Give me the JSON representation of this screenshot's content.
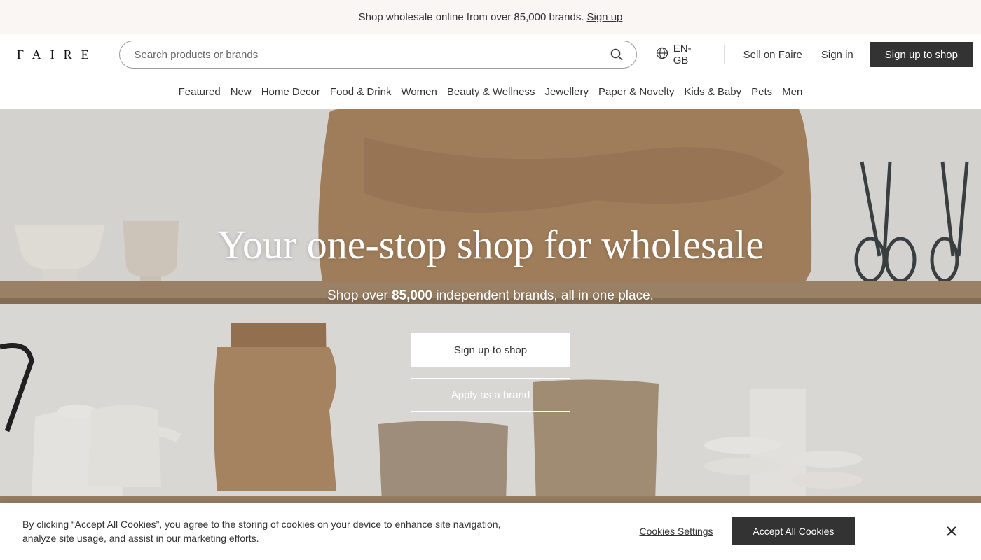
{
  "announcement": {
    "text": "Shop wholesale online from over 85,000 brands.",
    "link": "Sign up"
  },
  "header": {
    "logo": "FAIRE",
    "search_placeholder": "Search products or brands",
    "search_icon": "search-icon",
    "locale": "EN-GB",
    "locale_icon": "globe-icon",
    "sell_link": "Sell on Faire",
    "signin_link": "Sign in",
    "signup_button": "Sign up to shop"
  },
  "categories": [
    "Featured",
    "New",
    "Home Decor",
    "Food & Drink",
    "Women",
    "Beauty & Wellness",
    "Jewellery",
    "Paper & Novelty",
    "Kids & Baby",
    "Pets",
    "Men"
  ],
  "hero": {
    "title": "Your one-stop shop for wholesale",
    "subtitle_pre": "Shop over ",
    "subtitle_bold": "85,000",
    "subtitle_post": " independent brands, all in one place.",
    "primary_button": "Sign up to shop",
    "secondary_button": "Apply as a brand"
  },
  "cookie_banner": {
    "text": "By clicking “Accept All Cookies”, you agree to the storing of cookies on your device to enhance site navigation, analyze site usage, and assist in our marketing efforts.",
    "settings_link": "Cookies Settings",
    "accept_button": "Accept All Cookies",
    "close_icon": "close-icon"
  },
  "colors": {
    "announcement_bg": "#f9f6f3",
    "dark_button": "#333333",
    "hero_text": "#ffffff"
  }
}
